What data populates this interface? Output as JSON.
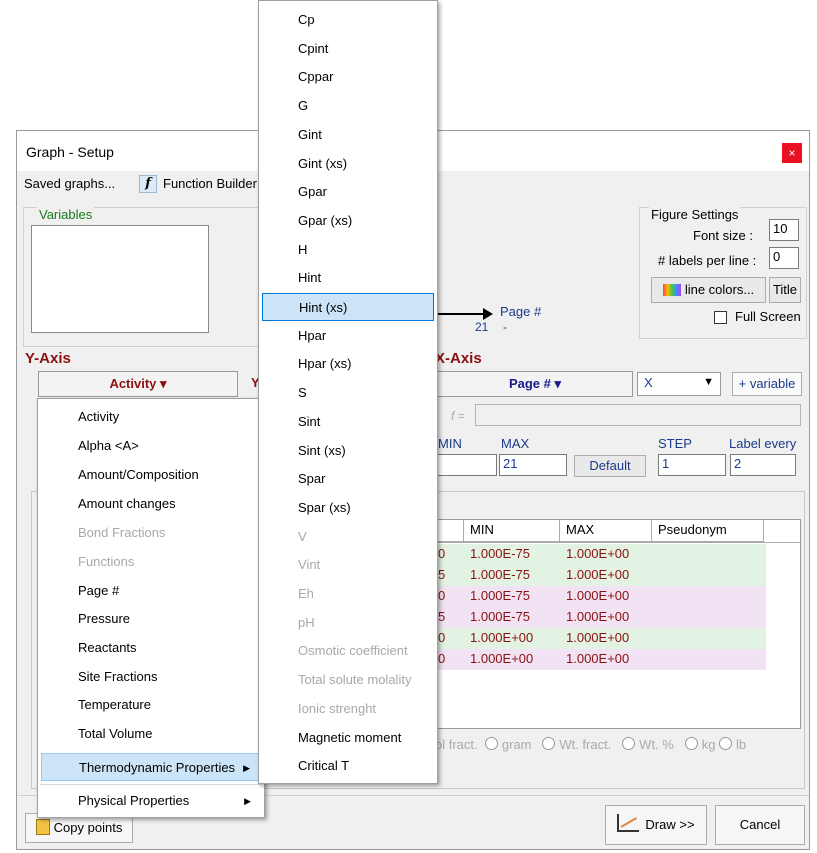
{
  "window": {
    "title": "Graph - Setup",
    "close_label": "×"
  },
  "menubar": {
    "saved_graphs": "Saved graphs...",
    "function_builder": "Function Builder",
    "fx_icon": "f"
  },
  "variables": {
    "label": "Variables"
  },
  "figure_settings": {
    "label": "Figure Settings",
    "font_size_label": "Font size :",
    "font_size_value": "10",
    "labels_per_line_label": "# labels per line :",
    "labels_per_line_value": "0",
    "line_colors": "line colors...",
    "title_button": "Title",
    "full_screen": "Full Screen"
  },
  "preview": {
    "page_label": "Page #",
    "page_value": "21",
    "dash": "-"
  },
  "y_axis": {
    "heading": "Y-Axis",
    "dropdown": "Activity",
    "side_letter": "Y"
  },
  "x_axis": {
    "heading": "X-Axis",
    "dropdown": "Page #",
    "var_select": "X",
    "add_variable": "+ variable",
    "f_label": "f =",
    "min_label": "MIN",
    "max_label": "MAX",
    "max_value": "21",
    "default_button": "Default",
    "step_label": "STEP",
    "step_value": "1",
    "label_every_label": "Label every",
    "label_every_value": "2"
  },
  "table": {
    "headers": [
      "MIN",
      "MAX",
      "Pseudonym"
    ],
    "rows": [
      {
        "left": "0",
        "min": "1.000E-75",
        "max": "1.000E+00",
        "bg": "#e3f3e3"
      },
      {
        "left": "5",
        "min": "1.000E-75",
        "max": "1.000E+00",
        "bg": "#e3f3e3"
      },
      {
        "left": "0",
        "min": "1.000E-75",
        "max": "1.000E+00",
        "bg": "#f1e3f3"
      },
      {
        "left": "5",
        "min": "1.000E-75",
        "max": "1.000E+00",
        "bg": "#f1e3f3"
      },
      {
        "left": "0",
        "min": "1.000E+00",
        "max": "1.000E+00",
        "bg": "#e3f3e3"
      },
      {
        "left": "0",
        "min": "1.000E+00",
        "max": "1.000E+00",
        "bg": "#f1e3f3"
      }
    ]
  },
  "units": [
    "ol fract.",
    "gram",
    "Wt. fract.",
    "Wt. %",
    "kg",
    "lb"
  ],
  "bottom": {
    "copy_points": "Copy points",
    "draw": "Draw >>",
    "cancel": "Cancel"
  },
  "y_menu": [
    {
      "label": "Activity",
      "enabled": true
    },
    {
      "label": "Alpha <A>",
      "enabled": true
    },
    {
      "label": "Amount/Composition",
      "enabled": true
    },
    {
      "label": "Amount changes",
      "enabled": true
    },
    {
      "label": "Bond Fractions",
      "enabled": false
    },
    {
      "label": "Functions",
      "enabled": false
    },
    {
      "label": "Page #",
      "enabled": true
    },
    {
      "label": "Pressure",
      "enabled": true
    },
    {
      "label": "Reactants",
      "enabled": true
    },
    {
      "label": "Site Fractions",
      "enabled": true
    },
    {
      "label": "Temperature",
      "enabled": true
    },
    {
      "label": "Total Volume",
      "enabled": true
    },
    {
      "label": "Thermodynamic Properties",
      "enabled": true,
      "submenu": true,
      "highlighted": true
    },
    {
      "label": "Physical Properties",
      "enabled": true,
      "submenu": true
    }
  ],
  "thermo_menu": [
    {
      "label": "Cp",
      "enabled": true
    },
    {
      "label": "Cpint",
      "enabled": true
    },
    {
      "label": "Cppar",
      "enabled": true
    },
    {
      "label": "G",
      "enabled": true
    },
    {
      "label": "Gint",
      "enabled": true
    },
    {
      "label": "Gint (xs)",
      "enabled": true
    },
    {
      "label": "Gpar",
      "enabled": true
    },
    {
      "label": "Gpar (xs)",
      "enabled": true
    },
    {
      "label": "H",
      "enabled": true
    },
    {
      "label": "Hint",
      "enabled": true
    },
    {
      "label": "Hint (xs)",
      "enabled": true,
      "highlighted": true
    },
    {
      "label": "Hpar",
      "enabled": true
    },
    {
      "label": "Hpar (xs)",
      "enabled": true
    },
    {
      "label": "S",
      "enabled": true
    },
    {
      "label": "Sint",
      "enabled": true
    },
    {
      "label": "Sint (xs)",
      "enabled": true
    },
    {
      "label": "Spar",
      "enabled": true
    },
    {
      "label": "Spar (xs)",
      "enabled": true
    },
    {
      "label": "V",
      "enabled": false
    },
    {
      "label": "Vint",
      "enabled": false
    },
    {
      "label": "Eh",
      "enabled": false
    },
    {
      "label": "pH",
      "enabled": false
    },
    {
      "label": "Osmotic coefficient",
      "enabled": false
    },
    {
      "label": "Total solute molality",
      "enabled": false
    },
    {
      "label": "Ionic strenght",
      "enabled": false
    },
    {
      "label": "Magnetic moment",
      "enabled": true
    },
    {
      "label": "Critical T",
      "enabled": true
    }
  ]
}
